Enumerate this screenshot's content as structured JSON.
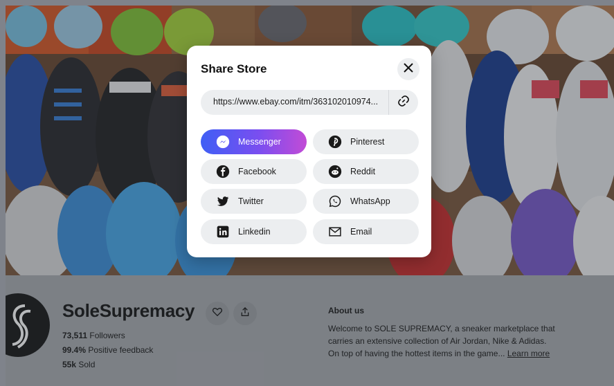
{
  "modal": {
    "title": "Share Store",
    "url": "https://www.ebay.com/itm/363102010974...",
    "share_options": [
      {
        "label": "Messenger",
        "icon": "messenger-icon"
      },
      {
        "label": "Pinterest",
        "icon": "pinterest-icon"
      },
      {
        "label": "Facebook",
        "icon": "facebook-icon"
      },
      {
        "label": "Reddit",
        "icon": "reddit-icon"
      },
      {
        "label": "Twitter",
        "icon": "twitter-icon"
      },
      {
        "label": "WhatsApp",
        "icon": "whatsapp-icon"
      },
      {
        "label": "Linkedin",
        "icon": "linkedin-icon"
      },
      {
        "label": "Email",
        "icon": "email-icon"
      }
    ],
    "icons": {
      "close": "close-icon",
      "copy": "link-icon"
    }
  },
  "store": {
    "name": "SoleSupremacy",
    "followers_count": "73,511",
    "followers_label": "Followers",
    "feedback_percent": "99.4%",
    "feedback_label": "Positive feedback",
    "sold_count": "55k",
    "sold_label": "Sold",
    "icons": {
      "save": "heart-icon",
      "share": "share-icon"
    }
  },
  "about": {
    "title": "About us",
    "text_line1": "Welcome to SOLE SUPREMACY, a sneaker marketplace that",
    "text_line2": "carries an extensive collection of Air Jordan, Nike & Adidas.",
    "text_line3": "On top of having the hottest items in the game...",
    "learn_more": "Learn more"
  },
  "colors": {
    "messenger_gradient_start": "#3f5ff5",
    "messenger_gradient_end": "#c24bd6",
    "overlay": "#22262e"
  }
}
